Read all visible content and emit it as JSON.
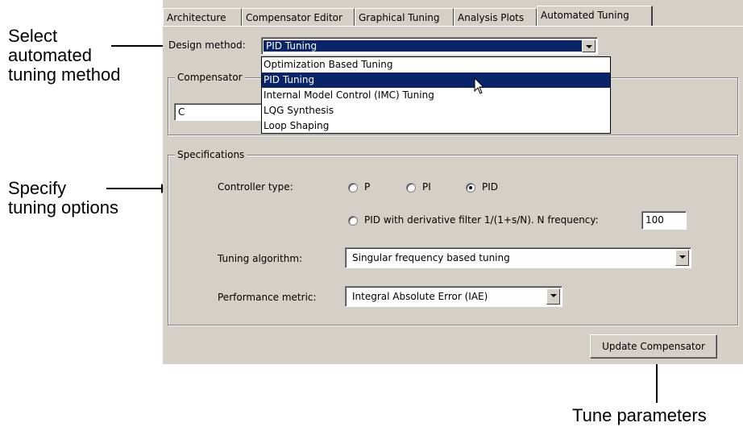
{
  "annotations": {
    "select_method": [
      "Select",
      "automated",
      "tuning method"
    ],
    "specify_options": [
      "Specify",
      "tuning options"
    ],
    "tune_parameters": "Tune parameters"
  },
  "tabs": [
    {
      "label": "Architecture",
      "active": false
    },
    {
      "label": "Compensator Editor",
      "active": false
    },
    {
      "label": "Graphical Tuning",
      "active": false
    },
    {
      "label": "Analysis Plots",
      "active": false
    },
    {
      "label": "Automated Tuning",
      "active": true
    }
  ],
  "design_method": {
    "label": "Design method:",
    "selected": "PID Tuning",
    "options": [
      {
        "label": "Optimization Based Tuning",
        "highlighted": false
      },
      {
        "label": "PID Tuning",
        "highlighted": true
      },
      {
        "label": "Internal Model Control (IMC) Tuning",
        "highlighted": false
      },
      {
        "label": "LQG Synthesis",
        "highlighted": false
      },
      {
        "label": "Loop Shaping",
        "highlighted": false
      }
    ]
  },
  "compensator": {
    "group_title": "Compensator",
    "value": "C"
  },
  "specifications": {
    "group_title": "Specifications",
    "controller_type": {
      "label": "Controller type:",
      "options": [
        {
          "label": "P",
          "checked": false
        },
        {
          "label": "PI",
          "checked": false
        },
        {
          "label": "PID",
          "checked": true
        }
      ],
      "pid_filter_label": "PID with derivative filter 1/(1+s/N). N frequency:",
      "pid_filter_checked": false,
      "n_frequency": "100"
    },
    "tuning_algorithm": {
      "label": "Tuning algorithm:",
      "value": "Singular frequency based tuning"
    },
    "performance_metric": {
      "label": "Performance metric:",
      "value": "Integral Absolute Error (IAE)"
    }
  },
  "update_button": "Update Compensator",
  "colors": {
    "panel": "#d4d0c8",
    "selection": "#0a246a"
  }
}
